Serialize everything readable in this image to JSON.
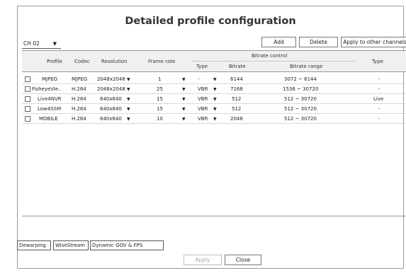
{
  "dialog": {
    "title": "Detailed profile configuration",
    "channel": {
      "selected": "CH 02",
      "arrow": "▼"
    },
    "buttons": {
      "add": "Add",
      "delete": "Delete",
      "apply_other": "Apply to other channels"
    },
    "table": {
      "headers": {
        "profile": "Profile",
        "codec": "Codec",
        "resolution": "Resolution",
        "frame_rate": "Frame rate",
        "bitrate_control": "Bitrate control",
        "type": "Type",
        "bitrate": "Bitrate",
        "bitrate_range": "Bitrate range",
        "type2": "Type"
      },
      "rows": [
        {
          "profile": "MJPEG",
          "codec": "MJPEG",
          "resolution": "2048x2048",
          "frame_rate": "1",
          "bc_type": "-",
          "bitrate": "6144",
          "range": "3072 ~ 6144",
          "type": "-"
        },
        {
          "profile": "FisheyeVie..",
          "codec": "H.264",
          "resolution": "2048x2048",
          "frame_rate": "25",
          "bc_type": "VBR",
          "bitrate": "7168",
          "range": "1536 ~ 30720",
          "type": "-"
        },
        {
          "profile": "Live4NVR",
          "codec": "H.264",
          "resolution": "640x640",
          "frame_rate": "15",
          "bc_type": "VBR",
          "bitrate": "512",
          "range": "512 ~ 30720",
          "type": "Live"
        },
        {
          "profile": "Low4SSM",
          "codec": "H.264",
          "resolution": "640x640",
          "frame_rate": "15",
          "bc_type": "VBR",
          "bitrate": "512",
          "range": "512 ~ 30720",
          "type": "-"
        },
        {
          "profile": "MOBILE",
          "codec": "H.264",
          "resolution": "640x640",
          "frame_rate": "10",
          "bc_type": "VBR",
          "bitrate": "2048",
          "range": "512 ~ 30720",
          "type": "-"
        }
      ]
    },
    "tabs": {
      "dewarping": "Dewarping",
      "wisestream": "WiseStream",
      "dynamic": "Dynamic GOV & FPS"
    },
    "footer": {
      "apply": "Apply",
      "close": "Close"
    }
  }
}
